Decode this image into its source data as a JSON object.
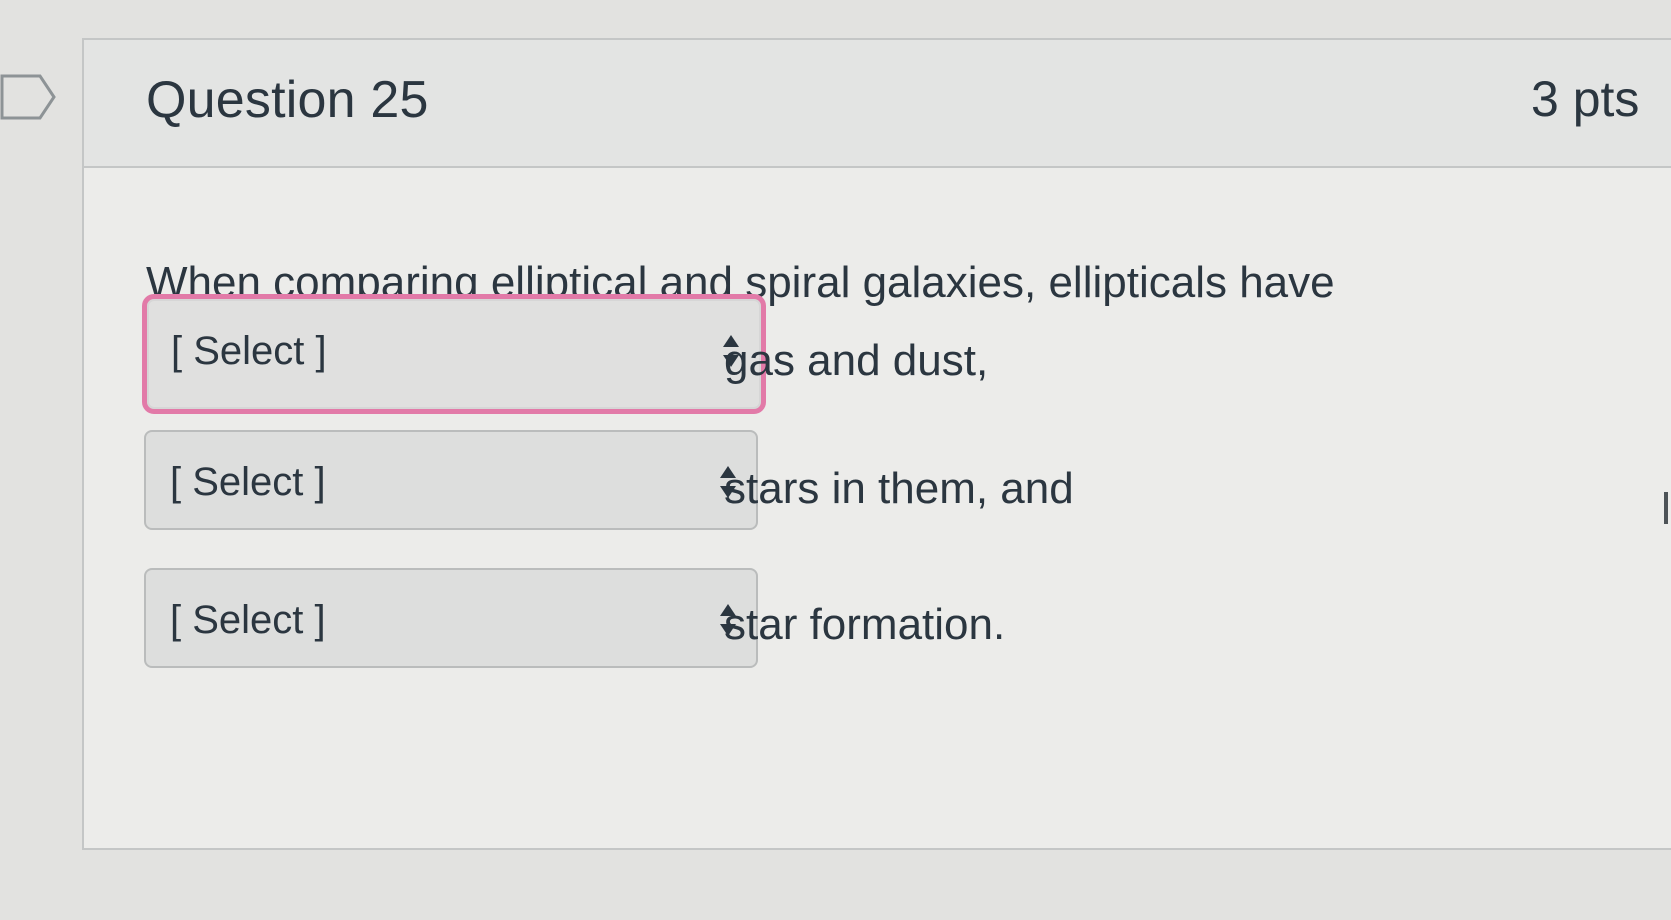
{
  "question": {
    "title": "Question 25",
    "points": "3 pts",
    "prompt": "When comparing elliptical and spiral galaxies, ellipticals have"
  },
  "blanks": [
    {
      "selected": "[ Select ]",
      "after_text": "gas and dust,",
      "focused": true
    },
    {
      "selected": "[ Select ]",
      "after_text": "stars in them, and",
      "focused": false
    },
    {
      "selected": "[ Select ]",
      "after_text": "star formation.",
      "focused": false
    }
  ],
  "icons": {
    "bookmark": "bookmark-flag-icon",
    "select_arrow": "up-down-caret-icon"
  },
  "colors": {
    "focus_ring": "#e27aa8",
    "text": "#2b3640",
    "header_bg": "#e3e4e3",
    "card_bg": "#ececea",
    "select_bg": "#dddedd"
  }
}
